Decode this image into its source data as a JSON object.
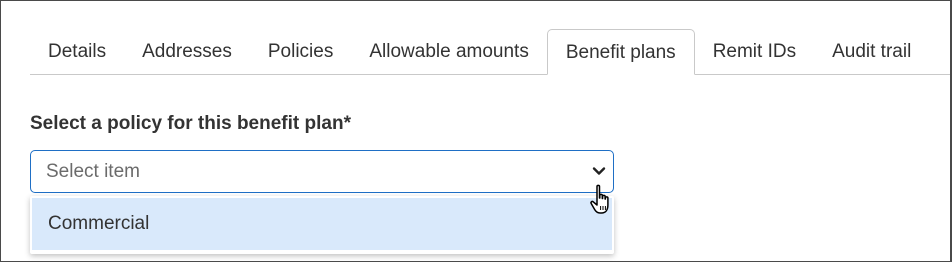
{
  "tabs": [
    {
      "label": "Details",
      "active": false
    },
    {
      "label": "Addresses",
      "active": false
    },
    {
      "label": "Policies",
      "active": false
    },
    {
      "label": "Allowable amounts",
      "active": false
    },
    {
      "label": "Benefit plans",
      "active": true
    },
    {
      "label": "Remit IDs",
      "active": false
    },
    {
      "label": "Audit trail",
      "active": false
    }
  ],
  "policy_field": {
    "label": "Select a policy for this benefit plan*",
    "placeholder": "Select item",
    "options": [
      "Commercial"
    ],
    "highlighted_option": "Commercial"
  },
  "colors": {
    "focus_border": "#1f6fc5",
    "option_highlight": "#d9e9fb",
    "tab_border": "#c9c9c9",
    "text": "#333333",
    "placeholder": "#6b6b6b"
  },
  "icons": {
    "select_arrow": "chevron-down-icon",
    "pointer": "hand-pointer-icon"
  }
}
